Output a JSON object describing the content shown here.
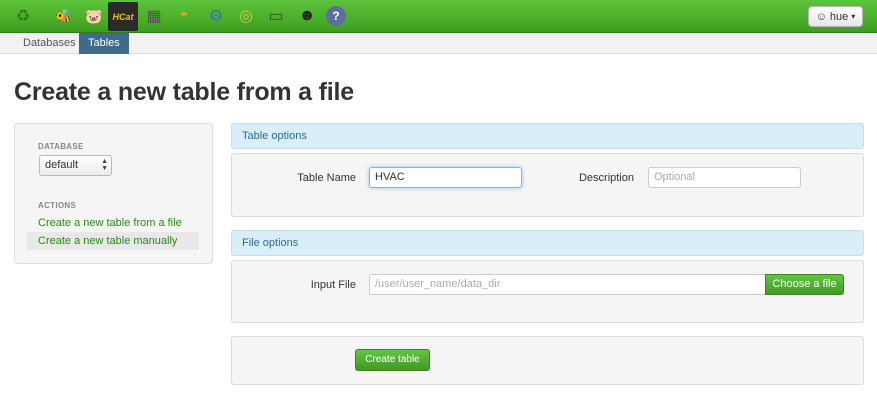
{
  "topbar": {
    "apps": [
      {
        "icon": "hue-logo-icon",
        "glyph": "♻",
        "color": "#2f7d14"
      },
      {
        "icon": "beeswax-icon",
        "glyph": "🐝",
        "color": "#e8d64a"
      },
      {
        "icon": "pig-icon",
        "glyph": "🐷",
        "color": "#f2a3a3"
      },
      {
        "icon": "hcat-icon",
        "glyph": "HCat",
        "color": "#f0c000"
      },
      {
        "icon": "file-browser-icon",
        "glyph": "▦",
        "color": "#6b6b6b"
      },
      {
        "icon": "oozie-icon",
        "glyph": "◓",
        "color": "#f0a020"
      },
      {
        "icon": "job-designer-icon",
        "glyph": "⚙",
        "color": "#3a6fc4"
      },
      {
        "icon": "job-browser-icon",
        "glyph": "◎",
        "color": "#d9c23a"
      },
      {
        "icon": "shell-icon",
        "glyph": "▭",
        "color": "#444444"
      },
      {
        "icon": "useradmin-icon",
        "glyph": "☻",
        "color": "#222222"
      },
      {
        "icon": "help-icon",
        "glyph": "?",
        "color": "#5a6fa0"
      }
    ],
    "user_label": "hue",
    "user_glyph": "☺",
    "caret": "▾"
  },
  "subnav": {
    "tabs": [
      {
        "label": "Databases"
      },
      {
        "label": "Tables"
      }
    ]
  },
  "page": {
    "title": "Create a new table from a file"
  },
  "sidebar": {
    "database_label": "DATABASE",
    "database_value": "default",
    "actions_label": "ACTIONS",
    "actions": [
      {
        "label": "Create a new table from a file"
      },
      {
        "label": "Create a new table manually"
      }
    ]
  },
  "table_options": {
    "header": "Table options",
    "name_label": "Table Name",
    "name_value": "HVAC",
    "description_label": "Description",
    "description_placeholder": "Optional"
  },
  "file_options": {
    "header": "File options",
    "input_label": "Input File",
    "input_placeholder": "/user/user_name/data_dir",
    "choose_label": "Choose a file"
  },
  "actions": {
    "create_label": "Create table"
  },
  "colors": {
    "brand_green": "#4caf2a",
    "link_green": "#2a8a12",
    "active_tab": "#3f6a8a",
    "section_blue": "#d9eef7"
  }
}
